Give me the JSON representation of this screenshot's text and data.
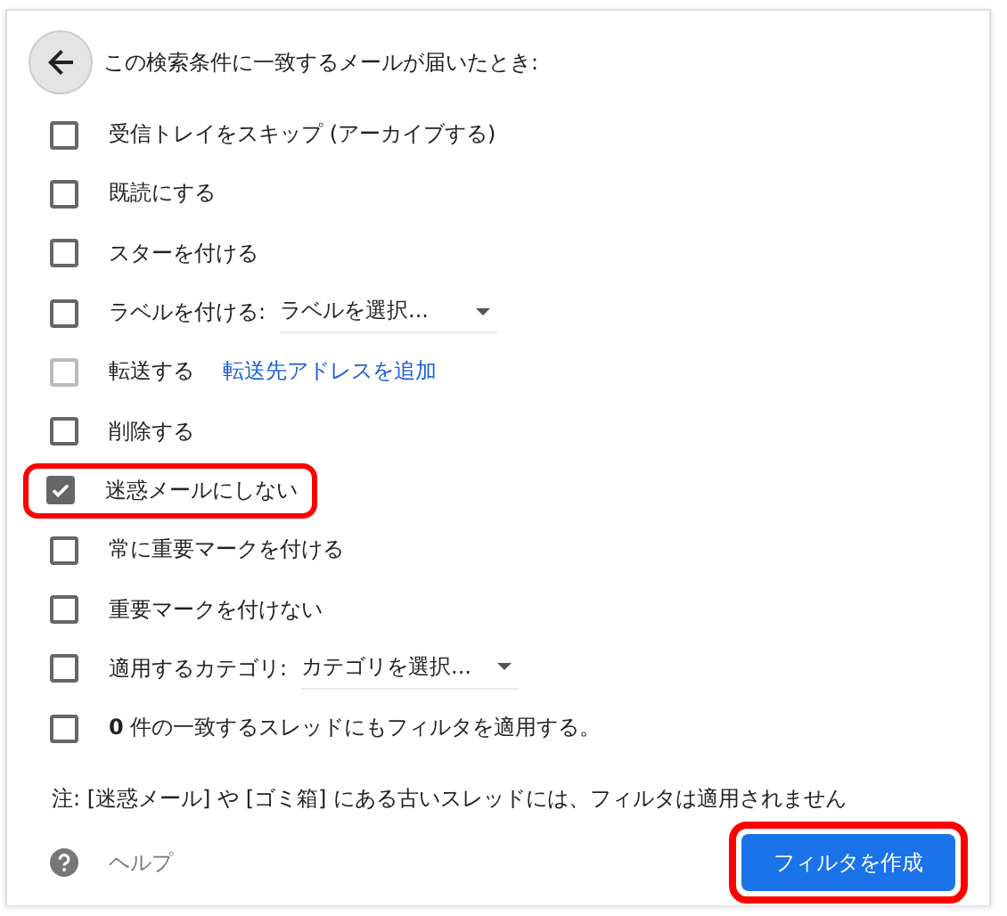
{
  "header": {
    "title": "この検索条件に一致するメールが届いたとき:"
  },
  "options": [
    {
      "kind": "plain",
      "label": "受信トレイをスキップ (アーカイブする)",
      "checked": false,
      "disabled": false,
      "highlighted": false
    },
    {
      "kind": "plain",
      "label": "既読にする",
      "checked": false,
      "disabled": false,
      "highlighted": false
    },
    {
      "kind": "plain",
      "label": "スターを付ける",
      "checked": false,
      "disabled": false,
      "highlighted": false
    },
    {
      "kind": "select",
      "label": "ラベルを付ける:",
      "value": "ラベルを選択...",
      "checked": false,
      "disabled": false,
      "highlighted": false
    },
    {
      "kind": "link",
      "label": "転送する",
      "link": "転送先アドレスを追加",
      "checked": false,
      "disabled": true,
      "highlighted": false
    },
    {
      "kind": "plain",
      "label": "削除する",
      "checked": false,
      "disabled": false,
      "highlighted": false
    },
    {
      "kind": "plain",
      "label": "迷惑メールにしない",
      "checked": true,
      "disabled": false,
      "highlighted": true
    },
    {
      "kind": "plain",
      "label": "常に重要マークを付ける",
      "checked": false,
      "disabled": false,
      "highlighted": false
    },
    {
      "kind": "plain",
      "label": "重要マークを付けない",
      "checked": false,
      "disabled": false,
      "highlighted": false
    },
    {
      "kind": "select",
      "label": "適用するカテゴリ:",
      "value": "カテゴリを選択...",
      "checked": false,
      "disabled": false,
      "highlighted": false
    },
    {
      "kind": "plain",
      "label": "**0** 件の一致するスレッドにもフィルタを適用する。",
      "checked": false,
      "disabled": false,
      "highlighted": false
    }
  ],
  "note": "注: [迷惑メール] や [ゴミ箱] にある古いスレッドには、フィルタは適用されません",
  "help": {
    "label": "ヘルプ"
  },
  "create_button": {
    "label": "フィルタを作成",
    "highlighted": true
  }
}
